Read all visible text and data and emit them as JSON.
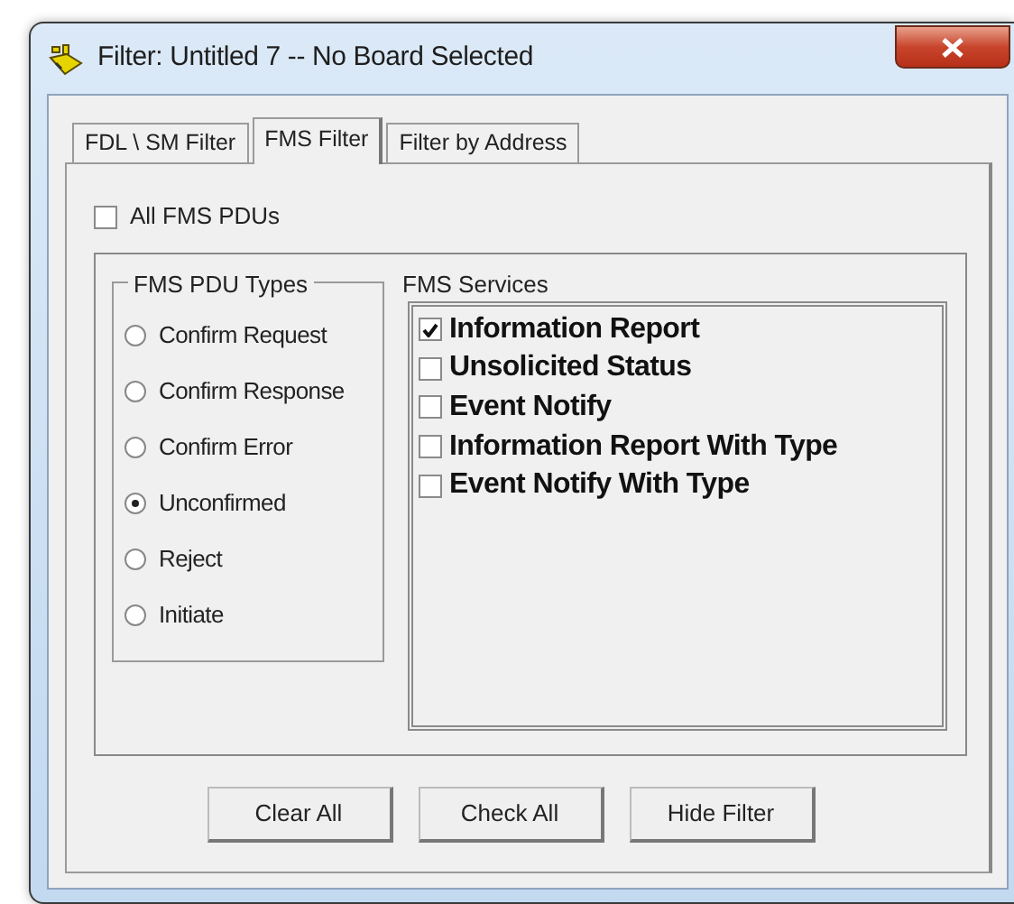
{
  "window": {
    "title": "Filter: Untitled 7 -- No Board Selected"
  },
  "tabs": [
    {
      "label": "FDL \\ SM Filter",
      "selected": false
    },
    {
      "label": "FMS Filter",
      "selected": true
    },
    {
      "label": "Filter by Address",
      "selected": false
    }
  ],
  "all_fms_pdus": {
    "label": "All FMS PDUs",
    "checked": false
  },
  "pdu_types": {
    "title": "FMS PDU Types",
    "options": [
      {
        "label": "Confirm Request",
        "selected": false
      },
      {
        "label": "Confirm Response",
        "selected": false
      },
      {
        "label": "Confirm Error",
        "selected": false
      },
      {
        "label": "Unconfirmed",
        "selected": true
      },
      {
        "label": "Reject",
        "selected": false
      },
      {
        "label": "Initiate",
        "selected": false
      }
    ]
  },
  "services": {
    "title": "FMS Services",
    "items": [
      {
        "label": "Information Report",
        "checked": true
      },
      {
        "label": "Unsolicited Status",
        "checked": false
      },
      {
        "label": "Event Notify",
        "checked": false
      },
      {
        "label": "Information Report With Type",
        "checked": false
      },
      {
        "label": "Event Notify With Type",
        "checked": false
      }
    ]
  },
  "buttons": [
    "Clear All",
    "Check All",
    "Hide Filter"
  ]
}
